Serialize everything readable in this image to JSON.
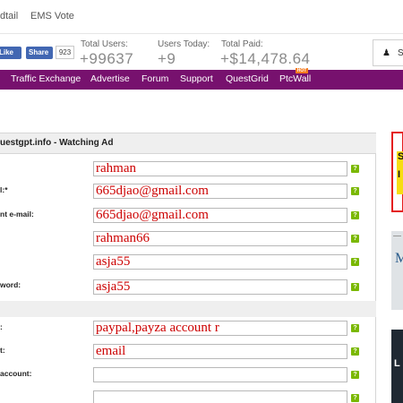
{
  "topnav": {
    "link1": "dtail",
    "link2": "EMS Vote"
  },
  "social": {
    "like": "Like",
    "share": "Share",
    "count": "923"
  },
  "stats": [
    {
      "label": "Total Users:",
      "value": "+99637"
    },
    {
      "label": "Users Today:",
      "value": "+9"
    },
    {
      "label": "Total Paid:",
      "value": "+$14,478.64"
    }
  ],
  "user_button": {
    "label": "Si"
  },
  "menu": {
    "items": [
      "Traffic Exchange",
      "Advertise",
      "Forum",
      "Support",
      "QuestGrid",
      "PtcWall"
    ],
    "hot_badge": "HOT"
  },
  "form": {
    "title": "uestgpt.info - Watching Ad",
    "fields": [
      {
        "label": "",
        "value": "rahman"
      },
      {
        "label": "l:*",
        "value": "665djao@gmail.com"
      },
      {
        "label": "nt e-mail:",
        "value": " 665djao@gmail.com"
      },
      {
        "label": "",
        "value": "rahman66"
      },
      {
        "label": "",
        "value": "asja55"
      },
      {
        "label": "word:",
        "value": "asja55"
      },
      {
        "label": ":",
        "value": "paypal,payza account r"
      },
      {
        "label": "t:",
        "value": "email"
      },
      {
        "label": " account:",
        "value": ""
      },
      {
        "label": "",
        "value": ""
      }
    ],
    "help_glyph": "?"
  },
  "ads": {
    "ad1_line1": "S",
    "ad1_line2": "I",
    "ad2_text": "M",
    "ad3_text": "L"
  },
  "colors": {
    "menu_bg": "#77116e",
    "field_text": "#cc0000",
    "help_bg": "#7ab800"
  }
}
